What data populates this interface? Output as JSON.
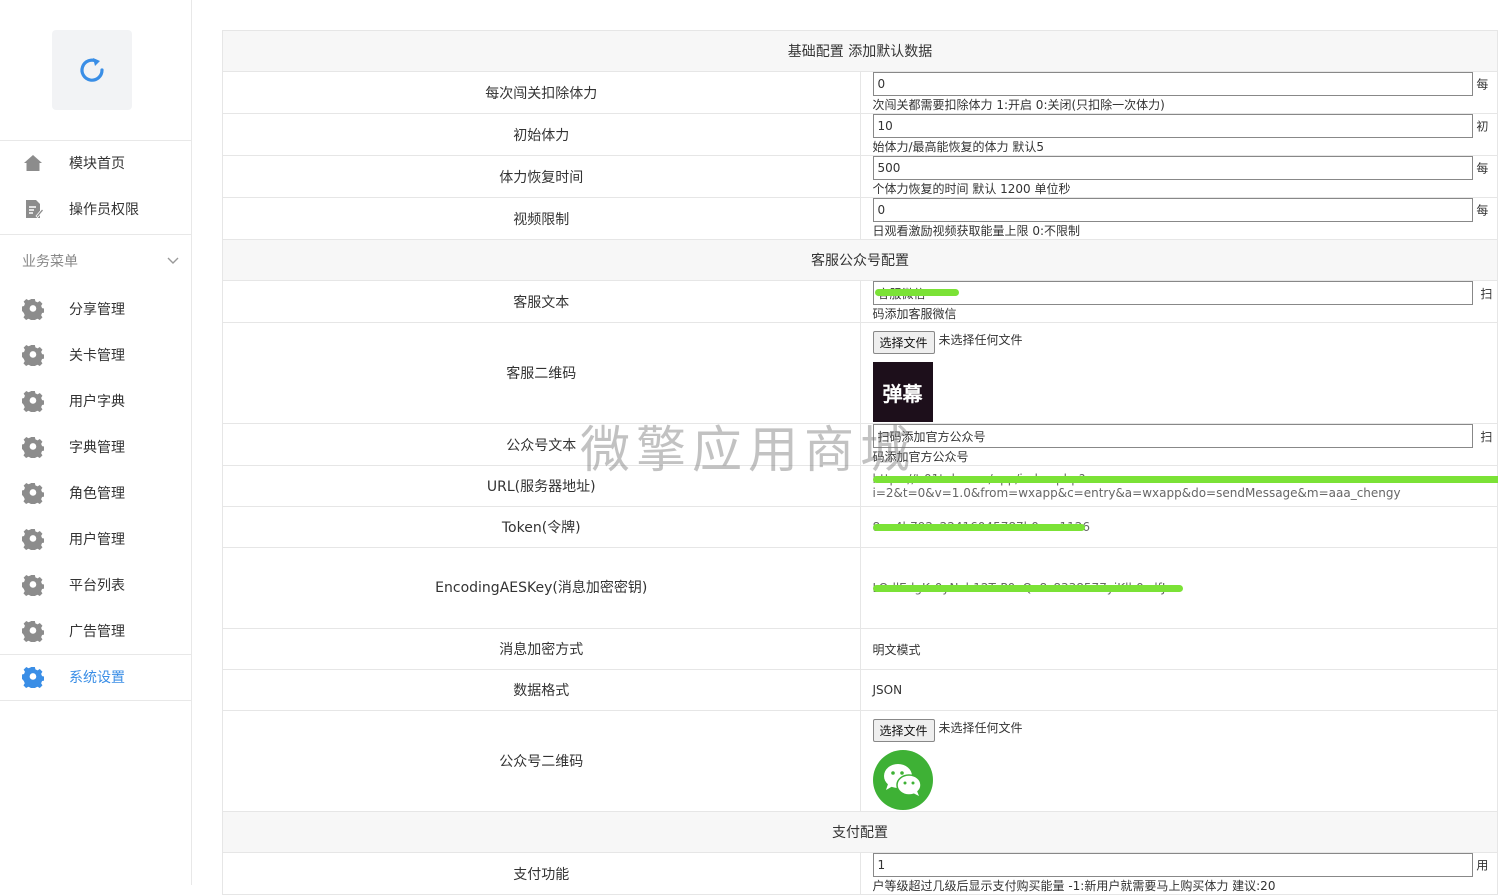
{
  "sidebar": {
    "items_top": [
      {
        "label": "模块首页",
        "icon": "home-icon"
      },
      {
        "label": "操作员权限",
        "icon": "edit-document-icon"
      }
    ],
    "section_title": "业务菜单",
    "items": [
      {
        "label": "分享管理",
        "icon": "gear-icon"
      },
      {
        "label": "关卡管理",
        "icon": "gear-icon"
      },
      {
        "label": "用户字典",
        "icon": "gear-icon"
      },
      {
        "label": "字典管理",
        "icon": "gear-icon"
      },
      {
        "label": "角色管理",
        "icon": "gear-icon"
      },
      {
        "label": "用户管理",
        "icon": "gear-icon"
      },
      {
        "label": "平台列表",
        "icon": "gear-icon"
      },
      {
        "label": "广告管理",
        "icon": "gear-icon"
      },
      {
        "label": "系统设置",
        "icon": "gear-icon",
        "active": true
      }
    ],
    "accent": "#3a8ee6"
  },
  "basic": {
    "header": "基础配置 添加默认数据",
    "rows": [
      {
        "label": "每次闯关扣除体力",
        "value": "0",
        "hint": "每次闯关都需要扣除体力 1:开启 0:关闭(只扣除一次体力)"
      },
      {
        "label": "初始体力",
        "value": "10",
        "hint": "初始体力/最高能恢复的体力 默认5"
      },
      {
        "label": "体力恢复时间",
        "value": "500",
        "hint": "每个体力恢复的时间 默认 1200 单位秒"
      },
      {
        "label": "视频限制",
        "value": "0",
        "hint": "每日观看激励视频获取能量上限 0:不限制"
      }
    ]
  },
  "service": {
    "header": "客服公众号配置",
    "text_label": "客服文本",
    "text_value": "客服微信",
    "text_hint": "扫码添加客服微信",
    "qr_label": "客服二维码",
    "choose_file": "选择文件",
    "no_file": "未选择任何文件",
    "qr_image_text": "弹幕",
    "oa_text_label": "公众号文本",
    "oa_text_value": "扫码添加官方公众号",
    "oa_text_hint": "扫码添加官方公众号",
    "url_label": "URL(服务器地址)",
    "url_value": "https://t.01tub.com/app/index.php?i=2&t=0&v=1.0&from=wxapp&c=entry&a=wxapp&do=sendMessage&m=aaa_chengy",
    "token_label": "Token(令牌)",
    "token_value": "8ea4b792c22416045787b0ecc1126",
    "aes_label": "EncodingAESKey(消息加密密钥)",
    "aes_value": "LOdlEdgKr0yNvb12TcP0eQe8z8338577yiKlh0zdfJ",
    "enc_label": "消息加密方式",
    "enc_value": "明文模式",
    "fmt_label": "数据格式",
    "fmt_value": "JSON",
    "oa_qr_label": "公众号二维码"
  },
  "payment": {
    "header": "支付配置",
    "rows": [
      {
        "label": "支付功能",
        "value": "1",
        "hint": "用户等级超过几级后显示支付购买能量 -1:新用户就需要马上购买体力 建议:20"
      }
    ]
  },
  "watermark": "微擎应用商城"
}
